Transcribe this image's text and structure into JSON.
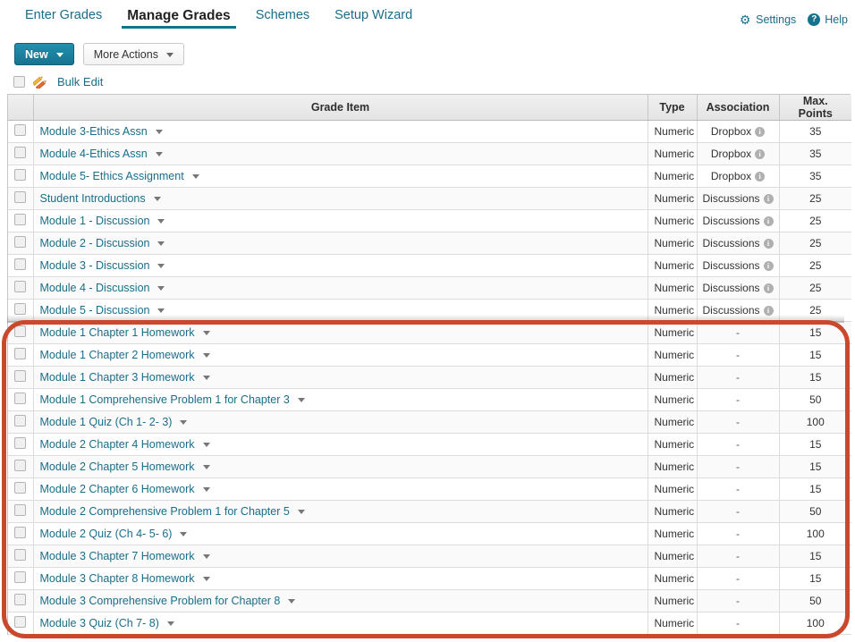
{
  "nav": {
    "tabs": [
      {
        "label": "Enter Grades",
        "active": false
      },
      {
        "label": "Manage Grades",
        "active": true
      },
      {
        "label": "Schemes",
        "active": false
      },
      {
        "label": "Setup Wizard",
        "active": false
      }
    ],
    "settings_label": "Settings",
    "settings_icon": "gear-icon",
    "help_label": "Help",
    "help_icon": "question-circle-icon",
    "accent_color": "#14728f",
    "link_color": "#1a6d8a"
  },
  "toolbar": {
    "new_label": "New",
    "more_actions_label": "More Actions"
  },
  "bulk_edit": {
    "label": "Bulk Edit",
    "icon": "pencils-icon"
  },
  "grid": {
    "columns": [
      "",
      "Grade Item",
      "Type",
      "Association",
      "Max. Points"
    ],
    "rows": [
      {
        "name": "Module 3-Ethics Assn",
        "type": "Numeric",
        "association": "Dropbox",
        "has_info": true,
        "max_points": "35"
      },
      {
        "name": "Module 4-Ethics Assn",
        "type": "Numeric",
        "association": "Dropbox",
        "has_info": true,
        "max_points": "35"
      },
      {
        "name": "Module 5- Ethics Assignment",
        "type": "Numeric",
        "association": "Dropbox",
        "has_info": true,
        "max_points": "35"
      },
      {
        "name": "Student Introductions",
        "type": "Numeric",
        "association": "Discussions",
        "has_info": true,
        "max_points": "25"
      },
      {
        "name": "Module 1 - Discussion",
        "type": "Numeric",
        "association": "Discussions",
        "has_info": true,
        "max_points": "25"
      },
      {
        "name": "Module 2 - Discussion",
        "type": "Numeric",
        "association": "Discussions",
        "has_info": true,
        "max_points": "25"
      },
      {
        "name": "Module 3 - Discussion",
        "type": "Numeric",
        "association": "Discussions",
        "has_info": true,
        "max_points": "25"
      },
      {
        "name": "Module 4 - Discussion",
        "type": "Numeric",
        "association": "Discussions",
        "has_info": true,
        "max_points": "25"
      },
      {
        "name": "Module 5 - Discussion",
        "type": "Numeric",
        "association": "Discussions",
        "has_info": true,
        "max_points": "25"
      },
      {
        "name": "Module 1 Chapter 1 Homework",
        "type": "Numeric",
        "association": "-",
        "has_info": false,
        "max_points": "15"
      },
      {
        "name": "Module 1 Chapter 2 Homework",
        "type": "Numeric",
        "association": "-",
        "has_info": false,
        "max_points": "15"
      },
      {
        "name": "Module 1 Chapter 3 Homework",
        "type": "Numeric",
        "association": "-",
        "has_info": false,
        "max_points": "15"
      },
      {
        "name": "Module 1 Comprehensive Problem 1 for Chapter 3",
        "type": "Numeric",
        "association": "-",
        "has_info": false,
        "max_points": "50"
      },
      {
        "name": "Module 1 Quiz (Ch 1- 2- 3)",
        "type": "Numeric",
        "association": "-",
        "has_info": false,
        "max_points": "100"
      },
      {
        "name": "Module 2 Chapter 4 Homework",
        "type": "Numeric",
        "association": "-",
        "has_info": false,
        "max_points": "15"
      },
      {
        "name": "Module 2 Chapter 5 Homework",
        "type": "Numeric",
        "association": "-",
        "has_info": false,
        "max_points": "15"
      },
      {
        "name": "Module 2 Chapter 6 Homework",
        "type": "Numeric",
        "association": "-",
        "has_info": false,
        "max_points": "15"
      },
      {
        "name": "Module 2 Comprehensive Problem 1 for Chapter 5",
        "type": "Numeric",
        "association": "-",
        "has_info": false,
        "max_points": "50"
      },
      {
        "name": "Module 2 Quiz (Ch 4- 5- 6)",
        "type": "Numeric",
        "association": "-",
        "has_info": false,
        "max_points": "100"
      },
      {
        "name": "Module 3 Chapter 7 Homework",
        "type": "Numeric",
        "association": "-",
        "has_info": false,
        "max_points": "15"
      },
      {
        "name": "Module 3 Chapter 8 Homework",
        "type": "Numeric",
        "association": "-",
        "has_info": false,
        "max_points": "15"
      },
      {
        "name": "Module 3 Comprehensive Problem for Chapter 8",
        "type": "Numeric",
        "association": "-",
        "has_info": false,
        "max_points": "50"
      },
      {
        "name": "Module 3 Quiz (Ch 7- 8)",
        "type": "Numeric",
        "association": "-",
        "has_info": false,
        "max_points": "100"
      }
    ]
  },
  "annotation": {
    "type": "rounded-rectangle-highlight",
    "color": "#c8492b",
    "first_row_index": 9,
    "last_row_index": 22
  }
}
